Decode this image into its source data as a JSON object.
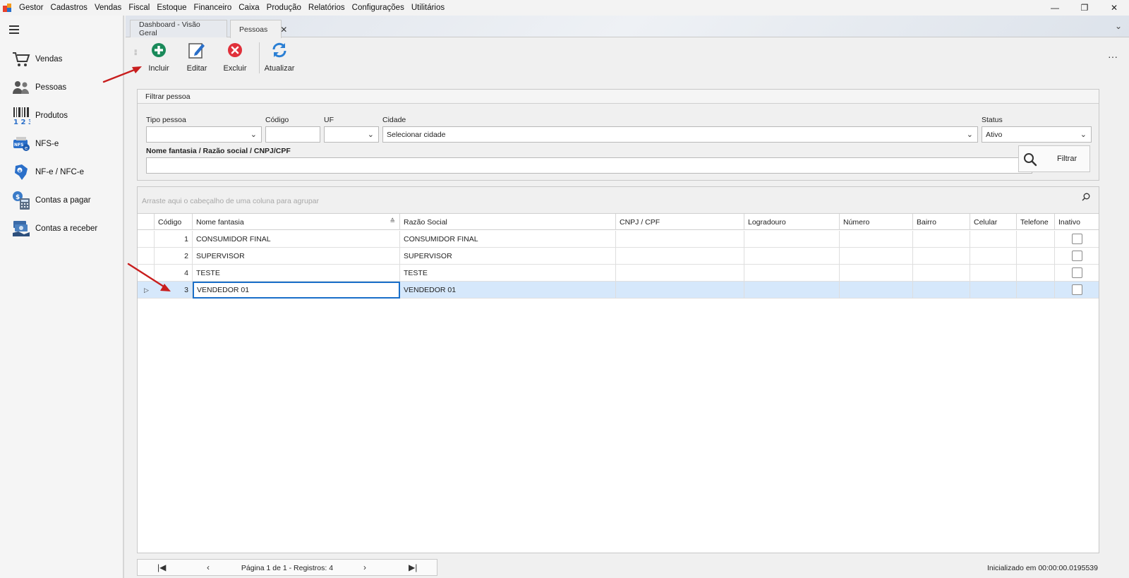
{
  "menubar": {
    "app_name": "Gestor",
    "items": [
      "Cadastros",
      "Vendas",
      "Fiscal",
      "Estoque",
      "Financeiro",
      "Caixa",
      "Produção",
      "Relatórios",
      "Configurações",
      "Utilitários"
    ],
    "window_controls": {
      "minimize": "—",
      "restore": "❐",
      "close": "✕"
    }
  },
  "sidebar": {
    "items": [
      {
        "label": "Vendas",
        "icon": "cart-icon"
      },
      {
        "label": "Pessoas",
        "icon": "people-icon"
      },
      {
        "label": "Produtos",
        "icon": "barcode-icon"
      },
      {
        "label": "NFS-e",
        "icon": "nfse-icon"
      },
      {
        "label": "NF-e / NFC-e",
        "icon": "nfe-map-icon"
      },
      {
        "label": "Contas a pagar",
        "icon": "calculator-icon"
      },
      {
        "label": "Contas a receber",
        "icon": "money-icon"
      }
    ]
  },
  "tabs": [
    {
      "label": "Dashboard - Visão Geral",
      "active": false
    },
    {
      "label": "Pessoas",
      "active": true,
      "close": "✕"
    }
  ],
  "toolbar": {
    "incluir": "Incluir",
    "editar": "Editar",
    "excluir": "Excluir",
    "atualizar": "Atualizar",
    "more": "···"
  },
  "filter": {
    "title": "Filtrar pessoa",
    "tipo_pessoa_label": "Tipo pessoa",
    "tipo_pessoa_value": "",
    "codigo_label": "Código",
    "codigo_value": "",
    "uf_label": "UF",
    "uf_value": "",
    "cidade_label": "Cidade",
    "cidade_value": "Selecionar cidade",
    "status_label": "Status",
    "status_value": "Ativo",
    "search_label": "Nome fantasia / Razão social / CNPJ/CPF",
    "search_value": "",
    "button_label": "Filtrar"
  },
  "grid": {
    "group_hint": "Arraste aqui o cabeçalho de uma coluna para agrupar",
    "columns": [
      "Código",
      "Nome fantasia",
      "Razão Social",
      "CNPJ / CPF",
      "Logradouro",
      "Número",
      "Bairro",
      "Celular",
      "Telefone",
      "Inativo"
    ],
    "rows": [
      {
        "codigo": "1",
        "nome_fantasia": "CONSUMIDOR FINAL",
        "razao_social": "CONSUMIDOR FINAL",
        "cnpj_cpf": "",
        "logradouro": "",
        "numero": "",
        "bairro": "",
        "celular": "",
        "telefone": "",
        "inativo": false
      },
      {
        "codigo": "2",
        "nome_fantasia": "SUPERVISOR",
        "razao_social": "SUPERVISOR",
        "cnpj_cpf": "",
        "logradouro": "",
        "numero": "",
        "bairro": "",
        "celular": "",
        "telefone": "",
        "inativo": false
      },
      {
        "codigo": "4",
        "nome_fantasia": "TESTE",
        "razao_social": "TESTE",
        "cnpj_cpf": "",
        "logradouro": "",
        "numero": "",
        "bairro": "",
        "celular": "",
        "telefone": "",
        "inativo": false
      },
      {
        "codigo": "3",
        "nome_fantasia": "VENDEDOR 01",
        "razao_social": "VENDEDOR 01",
        "cnpj_cpf": "",
        "logradouro": "",
        "numero": "",
        "bairro": "",
        "celular": "",
        "telefone": "",
        "inativo": false
      }
    ],
    "selected_row_indicator": "▷"
  },
  "pager": {
    "first": "|◀",
    "prev": "‹",
    "info": "Página 1 de 1 - Registros: 4",
    "next": "›",
    "last": "▶|"
  },
  "status": "Inicializado em 00:00:00.0195539",
  "colors": {
    "accent_green": "#1a8a5a",
    "accent_red": "#e0303a",
    "accent_blue": "#1a6fc9",
    "selection": "#d6e8fb",
    "annotation_arrow": "#c81e1e"
  }
}
